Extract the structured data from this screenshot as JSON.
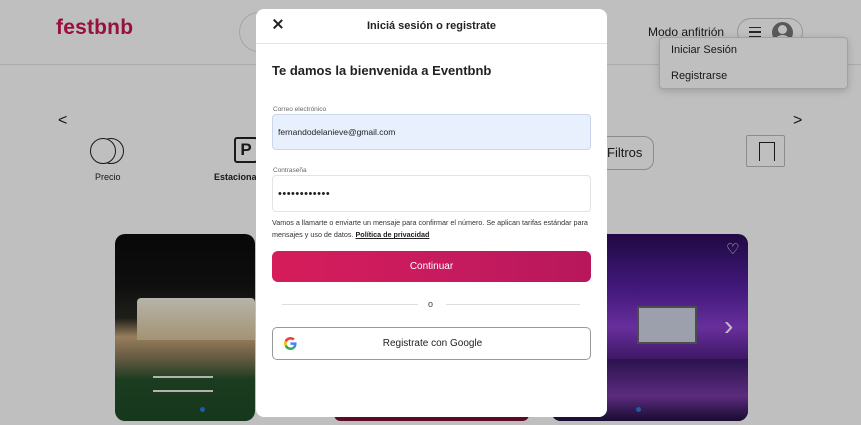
{
  "header": {
    "logo": "festbnb",
    "host_link": "Modo anfitrión"
  },
  "user_menu": {
    "items": [
      {
        "label": "Iniciar Sesión"
      },
      {
        "label": "Registrarse"
      }
    ]
  },
  "categories": {
    "prev": "<",
    "next": ">",
    "items": [
      {
        "label": "Precio",
        "icon": "coins-icon"
      },
      {
        "label": "Estacionam",
        "icon": "parking-icon"
      }
    ],
    "filters_label": "Filtros"
  },
  "modal": {
    "title": "Iniciá sesión o registrate",
    "welcome": "Te damos la bienvenida a Eventbnb",
    "email": {
      "label": "Correo electrónico",
      "value": "fernandodelanieve@gmail.com"
    },
    "password": {
      "label": "Contraseña",
      "value": "••••••••••••"
    },
    "disclaimer": "Vamos a llamarte o enviarte un mensaje para confirmar el número. Se aplican tarifas estándar para mensajes y uso de datos.",
    "privacy_link": "Política de privacidad",
    "continue_label": "Continuar",
    "divider": "o",
    "google_label": "Registrate con Google"
  },
  "colors": {
    "brand": "#c8174f",
    "continue_start": "#d61c5a",
    "continue_end": "#b8175c",
    "email_fill": "#e8f0fe"
  }
}
